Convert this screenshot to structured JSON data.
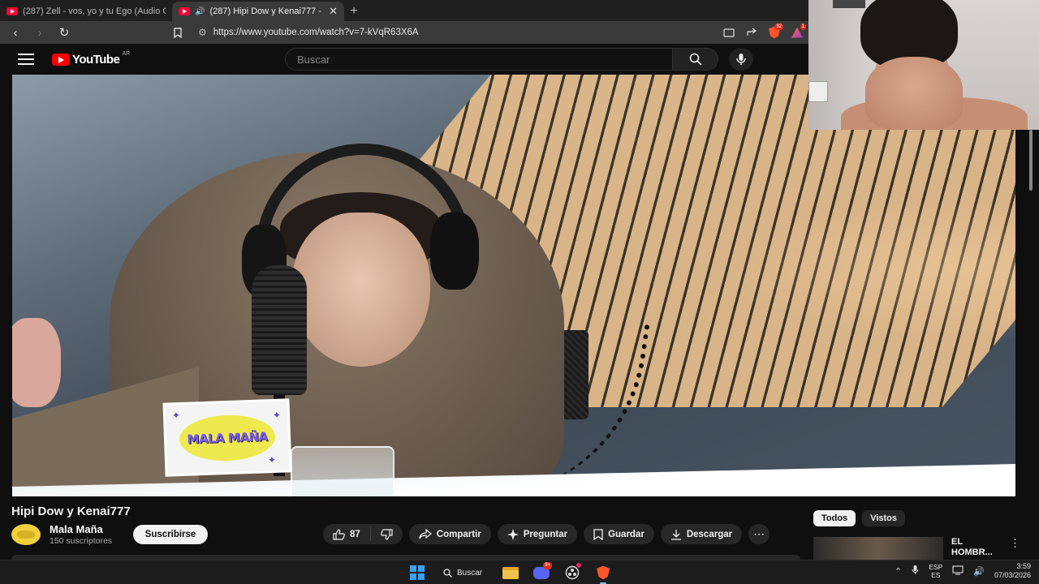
{
  "browser": {
    "tabs": [
      {
        "title": "(287) Zell - vos, yo y tu Ego (Audio O",
        "active": false
      },
      {
        "title": "(287) Hipi Dow y Kenai777 - Y",
        "active": true
      }
    ],
    "url": "https://www.youtube.com/watch?v=7-kVqR63X6A",
    "extension_badges": {
      "brave": "32",
      "rewards": "1"
    }
  },
  "youtube": {
    "logo_text": "YouTube",
    "country_code": "AR",
    "search_placeholder": "Buscar"
  },
  "video": {
    "title": "Hipi Dow y Kenai777",
    "sticker_text": "MALA MAÑA"
  },
  "channel": {
    "name": "Mala Maña",
    "subscribers": "150 suscriptores",
    "subscribe_label": "Suscribirse"
  },
  "actions": {
    "likes": "87",
    "share": "Compartir",
    "ask": "Preguntar",
    "save": "Guardar",
    "download": "Descargar"
  },
  "sidebar": {
    "chips": [
      "Todos",
      "Vistos"
    ],
    "active_chip": "Todos",
    "recommendation_title": "EL HOMBR..."
  },
  "taskbar": {
    "search_label": "Buscar",
    "discord_badge": "9+",
    "language": "ESP",
    "layout": "ES",
    "time": "3:59",
    "date": "07/03/2026"
  },
  "colors": {
    "youtube_red": "#ff0000",
    "background": "#0f0f0f",
    "pill": "#272727",
    "windows_blue": "#3aa0f0"
  }
}
